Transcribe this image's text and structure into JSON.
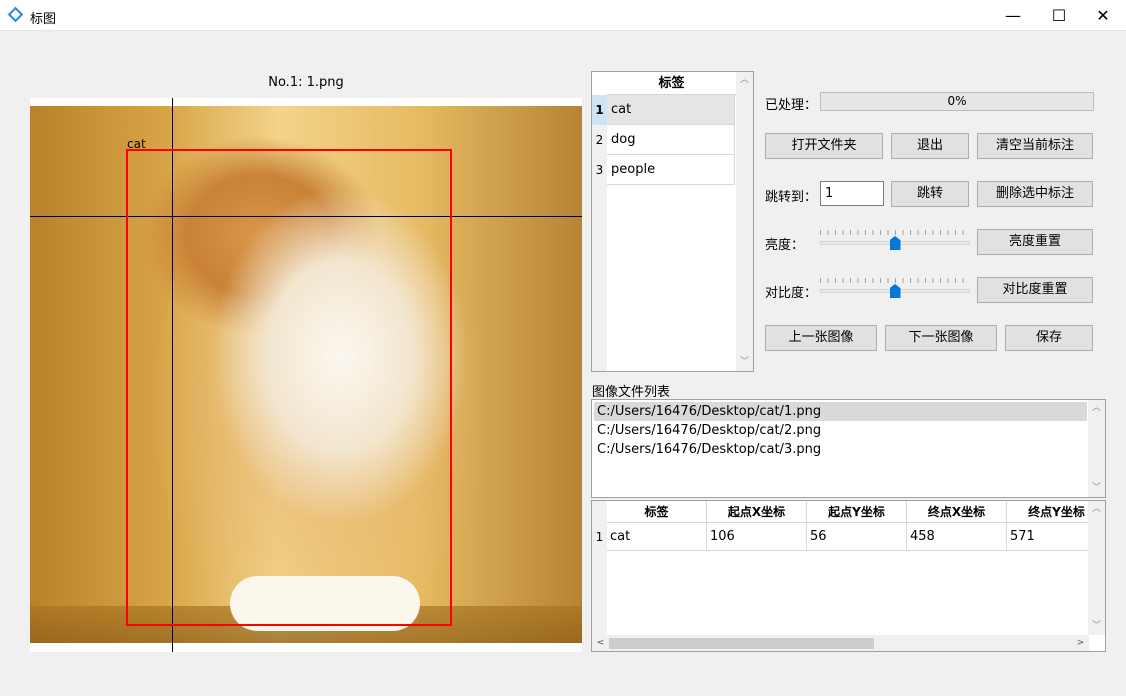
{
  "window": {
    "title": "标图",
    "controls": {
      "minimize": "—",
      "maximize": "☐",
      "close": "✕"
    }
  },
  "image_view": {
    "caption": "No.1: 1.png",
    "annotation_label": "cat"
  },
  "label_table": {
    "header": "标签",
    "rows": [
      {
        "num": "1",
        "label": "cat"
      },
      {
        "num": "2",
        "label": "dog"
      },
      {
        "num": "3",
        "label": "people"
      }
    ]
  },
  "controls": {
    "processed_label": "已处理：",
    "progress_percent": 0,
    "progress_text": "0%",
    "open_folder": "打开文件夹",
    "exit": "退出",
    "clear_current": "清空当前标注",
    "jump_label": "跳转到：",
    "jump_value": "1",
    "jump_button": "跳转",
    "delete_selected": "删除选中标注",
    "brightness_label": "亮度：",
    "brightness_reset": "亮度重置",
    "brightness_level": 0.5,
    "contrast_label": "对比度：",
    "contrast_reset": "对比度重置",
    "contrast_level": 0.5,
    "prev_image": "上一张图像",
    "next_image": "下一张图像",
    "save": "保存"
  },
  "file_list": {
    "title": "图像文件列表",
    "items": [
      "C:/Users/16476/Desktop/cat/1.png",
      "C:/Users/16476/Desktop/cat/2.png",
      "C:/Users/16476/Desktop/cat/3.png"
    ]
  },
  "coord_table": {
    "headers": [
      "标签",
      "起点X坐标",
      "起点Y坐标",
      "终点X坐标",
      "终点Y坐标"
    ],
    "rows": [
      {
        "num": "1",
        "cells": [
          "cat",
          "106",
          "56",
          "458",
          "571"
        ]
      }
    ]
  }
}
